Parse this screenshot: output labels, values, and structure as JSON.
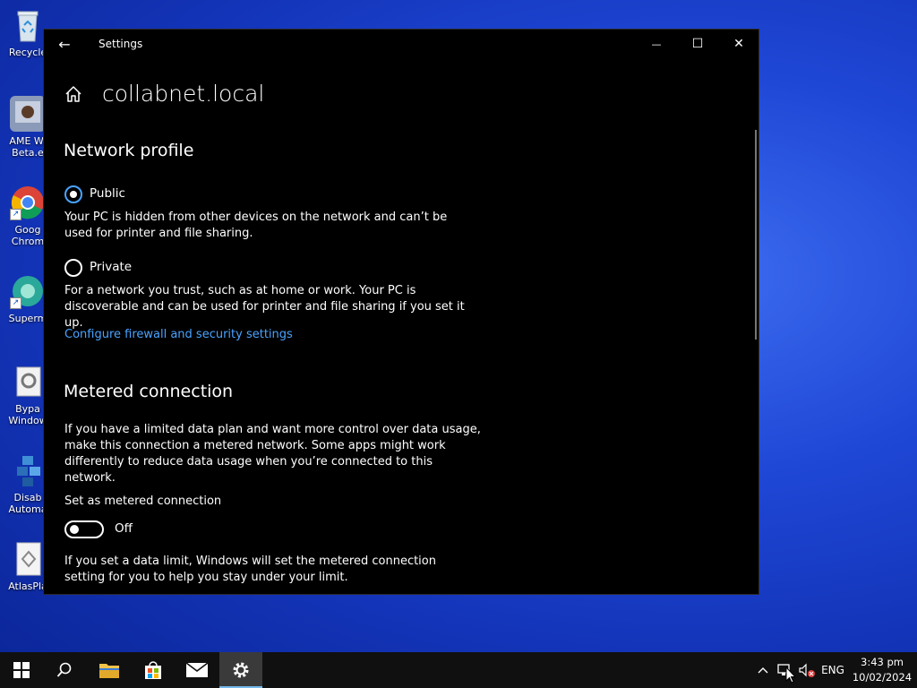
{
  "desktop": {
    "icons": [
      {
        "label_line1": "Recycle",
        "label_line2": "",
        "name": "recycle-bin"
      },
      {
        "label_line1": "AME Wi",
        "label_line2": "Beta.e",
        "name": "ame-wizard"
      },
      {
        "label_line1": "Goog",
        "label_line2": "Chrom",
        "name": "google-chrome"
      },
      {
        "label_line1": "Superm",
        "label_line2": "",
        "name": "supermium"
      },
      {
        "label_line1": "Bypa",
        "label_line2": "Window",
        "name": "bypass-windows"
      },
      {
        "label_line1": "Disab",
        "label_line2": "Automa",
        "name": "disable-automatic"
      },
      {
        "label_line1": "AtlasPla",
        "label_line2": "",
        "name": "atlas-playbook"
      }
    ]
  },
  "window": {
    "title": "Settings",
    "back_glyph": "←",
    "minimize_glyph": "—",
    "maximize_glyph": "☐",
    "close_glyph": "✕"
  },
  "page": {
    "title": "collabnet.local",
    "network_profile": {
      "heading": "Network profile",
      "options": [
        {
          "label": "Public",
          "checked": true,
          "description": "Your PC is hidden from other devices on the network and can’t be used for printer and file sharing."
        },
        {
          "label": "Private",
          "checked": false,
          "description": "For a network you trust, such as at home or work. Your PC is discoverable and can be used for printer and file sharing if you set it up."
        }
      ],
      "link": "Configure firewall and security settings"
    },
    "metered": {
      "heading": "Metered connection",
      "description": "If you have a limited data plan and want more control over data usage, make this connection a metered network. Some apps might work differently to reduce data usage when you’re connected to this network.",
      "toggle_label": "Set as metered connection",
      "toggle_state": "Off",
      "toggle_on": false,
      "limit_note": "If you set a data limit, Windows will set the metered connection setting for you to help you stay under your limit."
    }
  },
  "taskbar": {
    "apps": [
      {
        "name": "start-icon",
        "active": false
      },
      {
        "name": "search-icon",
        "active": false
      },
      {
        "name": "file-explorer-icon",
        "active": false
      },
      {
        "name": "store-icon",
        "active": false
      },
      {
        "name": "mail-icon",
        "active": false
      },
      {
        "name": "settings-icon",
        "active": true
      }
    ],
    "tray": {
      "chevron": "^",
      "language": "ENG"
    },
    "clock": {
      "time": "3:43 pm",
      "date": "10/02/2024"
    }
  },
  "colors": {
    "accent": "#4aa3ff",
    "window_bg": "#000000",
    "taskbar_bg": "#101010",
    "desktop_blue": "#1f47d6"
  }
}
